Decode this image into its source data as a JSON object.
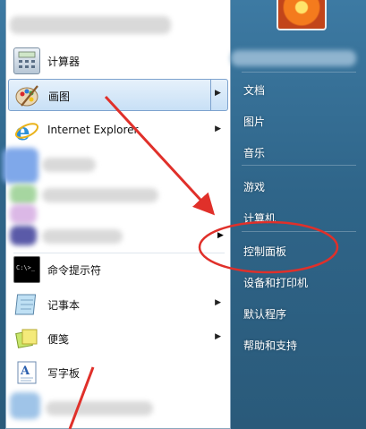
{
  "start_menu": {
    "programs": [
      {
        "label": "计算器"
      },
      {
        "label": "画图"
      },
      {
        "label": "Internet Explorer"
      },
      {
        "label": "命令提示符"
      },
      {
        "label": "记事本"
      },
      {
        "label": "便笺"
      },
      {
        "label": "写字板"
      }
    ],
    "right_pane": [
      {
        "label": "文档"
      },
      {
        "label": "图片"
      },
      {
        "label": "音乐"
      },
      {
        "label": "游戏"
      },
      {
        "label": "计算机"
      },
      {
        "label": "控制面板"
      },
      {
        "label": "设备和打印机"
      },
      {
        "label": "默认程序"
      },
      {
        "label": "帮助和支持"
      }
    ],
    "cmd_icon_text": "C:\\>_"
  },
  "colors": {
    "annotation_red": "#e0302a",
    "selection_blue": "#c8e0f6",
    "right_pane_blue": "#2f6589"
  }
}
